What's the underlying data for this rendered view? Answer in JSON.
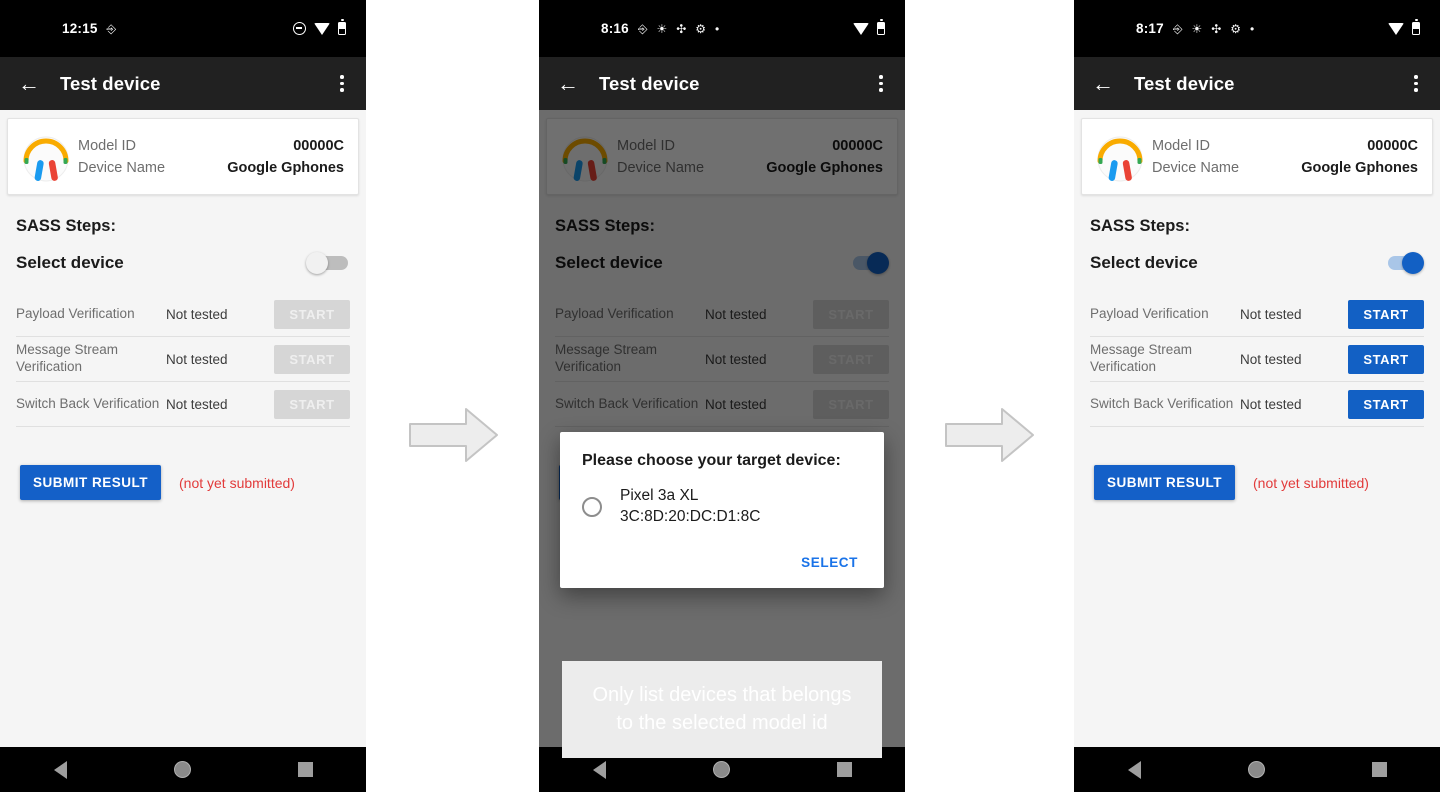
{
  "screens": [
    {
      "id": "screen-initial",
      "status_bar": {
        "time": "12:15",
        "left_icons": [
          "screenshot-icon"
        ],
        "right_icons": [
          "dnd-icon",
          "wifi-icon",
          "battery-icon"
        ]
      },
      "app_bar": {
        "back": "back-arrow-icon",
        "title": "Test device",
        "overflow": "overflow-menu-icon"
      },
      "device_card": {
        "icon": "headphones-icon",
        "rows": [
          {
            "key": "Model ID",
            "value": "00000C"
          },
          {
            "key": "Device Name",
            "value": "Google Gphones"
          }
        ]
      },
      "sass": {
        "heading": "SASS Steps:",
        "select_device_label": "Select device",
        "toggle_on": false
      },
      "tests": [
        {
          "name": "Payload Verification",
          "status": "Not tested",
          "button": "START",
          "enabled": false
        },
        {
          "name": "Message Stream Verification",
          "status": "Not tested",
          "button": "START",
          "enabled": false
        },
        {
          "name": "Switch Back Verification",
          "status": "Not tested",
          "button": "START",
          "enabled": false
        }
      ],
      "submit": {
        "label": "SUBMIT RESULT",
        "note": "(not yet submitted)"
      },
      "nav_bar": [
        "back-triangle-icon",
        "home-circle-icon",
        "recents-square-icon"
      ],
      "dialog": null,
      "annotation": null,
      "scrim": false
    },
    {
      "id": "screen-device-picker",
      "status_bar": {
        "time": "8:16",
        "left_icons": [
          "screenshot-icon",
          "brightness-icon",
          "bluetooth-share-icon",
          "settings-gear-icon",
          "dot-icon"
        ],
        "right_icons": [
          "wifi-icon",
          "battery-icon"
        ]
      },
      "app_bar": {
        "back": "back-arrow-icon",
        "title": "Test device",
        "overflow": "overflow-menu-icon"
      },
      "device_card": {
        "icon": "headphones-icon",
        "rows": [
          {
            "key": "Model ID",
            "value": "00000C"
          },
          {
            "key": "Device Name",
            "value": "Google Gphones"
          }
        ]
      },
      "sass": {
        "heading": "SASS Steps:",
        "select_device_label": "Select device",
        "toggle_on": true
      },
      "tests": [
        {
          "name": "Payload Verification",
          "status": "Not tested",
          "button": "START",
          "enabled": false
        },
        {
          "name": "Message Stream Verification",
          "status": "Not tested",
          "button": "START",
          "enabled": false
        },
        {
          "name": "Switch Back Verification",
          "status": "Not tested",
          "button": "START",
          "enabled": false
        }
      ],
      "submit": {
        "label": "SUBMIT RESULT",
        "note": "(not yet submitted)"
      },
      "nav_bar": [
        "back-triangle-icon",
        "home-circle-icon",
        "recents-square-icon"
      ],
      "dialog": {
        "title": "Please choose your target device:",
        "option": {
          "name": "Pixel 3a XL",
          "mac": "3C:8D:20:DC:D1:8C",
          "selected": false
        },
        "action": "SELECT"
      },
      "annotation": "Only list devices that belongs to the selected model id",
      "scrim": true
    },
    {
      "id": "screen-device-selected",
      "status_bar": {
        "time": "8:17",
        "left_icons": [
          "screenshot-icon",
          "brightness-icon",
          "bluetooth-share-icon",
          "settings-gear-icon",
          "dot-icon"
        ],
        "right_icons": [
          "wifi-icon",
          "battery-icon"
        ]
      },
      "app_bar": {
        "back": "back-arrow-icon",
        "title": "Test device",
        "overflow": "overflow-menu-icon"
      },
      "device_card": {
        "icon": "headphones-icon",
        "rows": [
          {
            "key": "Model ID",
            "value": "00000C"
          },
          {
            "key": "Device Name",
            "value": "Google Gphones"
          }
        ]
      },
      "sass": {
        "heading": "SASS Steps:",
        "select_device_label": "Select device",
        "toggle_on": true
      },
      "tests": [
        {
          "name": "Payload Verification",
          "status": "Not tested",
          "button": "START",
          "enabled": true
        },
        {
          "name": "Message Stream Verification",
          "status": "Not tested",
          "button": "START",
          "enabled": true
        },
        {
          "name": "Switch Back Verification",
          "status": "Not tested",
          "button": "START",
          "enabled": true
        }
      ],
      "submit": {
        "label": "SUBMIT RESULT",
        "note": "(not yet submitted)"
      },
      "nav_bar": [
        "back-triangle-icon",
        "home-circle-icon",
        "recents-square-icon"
      ],
      "dialog": null,
      "annotation": null,
      "scrim": false
    }
  ],
  "flow_arrows": [
    {
      "name": "flow-arrow-1",
      "direction": "right"
    },
    {
      "name": "flow-arrow-2",
      "direction": "right"
    }
  ],
  "colors": {
    "accent_blue": "#1260c4",
    "link_blue": "#1a73e8",
    "error_red": "#e23b3b",
    "disabled_gray": "#d6d6d6",
    "appbar_dark": "#212121",
    "page_background": "#f5f5f5"
  }
}
